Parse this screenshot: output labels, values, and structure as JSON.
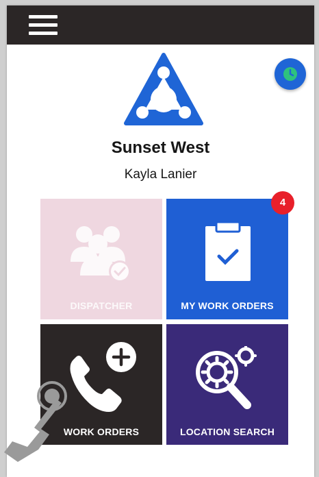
{
  "org": {
    "name": "Sunset West",
    "user": "Kayla Lanier"
  },
  "tiles": {
    "dispatcher": {
      "label": "DISPATCHER",
      "color": "#efd7e0"
    },
    "my_work_orders": {
      "label": "MY WORK ORDERS",
      "badge": "4",
      "color": "#1f5fd4"
    },
    "work_orders": {
      "label": "WORK ORDERS",
      "color": "#2b2626"
    },
    "location_search": {
      "label": "LOCATION SEARCH",
      "color": "#3a2a79"
    }
  },
  "icons": {
    "menu": "hamburger-icon",
    "clock": "clock-icon",
    "logo": "triangle-logo",
    "dispatcher": "people-check-icon",
    "my_work_orders": "clipboard-check-icon",
    "work_orders": "phone-plus-icon",
    "location_search": "search-gear-icon",
    "touch": "touch-hand-icon"
  },
  "colors": {
    "topbar": "#2b2626",
    "accent": "#1f65d6",
    "badge": "#e8202a"
  }
}
